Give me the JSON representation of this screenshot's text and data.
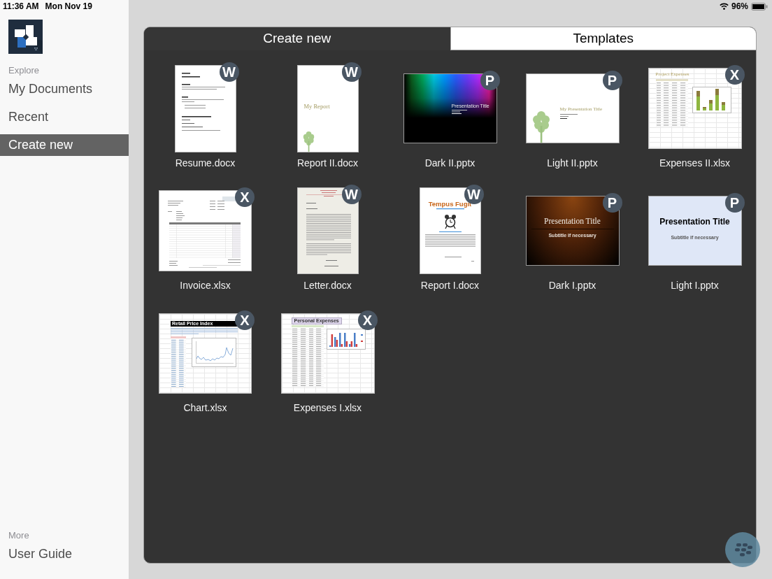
{
  "status_bar": {
    "time": "11:36 AM",
    "date": "Mon Nov 19",
    "battery": "96%"
  },
  "sidebar": {
    "sections": [
      {
        "heading": "Explore",
        "items": [
          {
            "label": "My Documents",
            "selected": false
          },
          {
            "label": "Recent",
            "selected": false
          },
          {
            "label": "Create new",
            "selected": true
          }
        ]
      },
      {
        "heading": "More",
        "items": [
          {
            "label": "User Guide",
            "selected": false
          }
        ]
      }
    ]
  },
  "tabs": [
    {
      "label": "Create new",
      "selected": true
    },
    {
      "label": "Templates",
      "selected": false
    }
  ],
  "templates": [
    {
      "name": "Resume.docx",
      "badge": "W",
      "preview": {
        "kind": "resume"
      }
    },
    {
      "name": "Report II.docx",
      "badge": "W",
      "preview": {
        "kind": "report",
        "title": "My Report"
      }
    },
    {
      "name": "Dark II.pptx",
      "badge": "P",
      "preview": {
        "kind": "spectrum-slide",
        "title": "Presentation Title"
      }
    },
    {
      "name": "Light II.pptx",
      "badge": "P",
      "preview": {
        "kind": "tree-slide",
        "title": "My Presentation Title"
      }
    },
    {
      "name": "Expenses II.xlsx",
      "badge": "X",
      "preview": {
        "kind": "expenses-sheet",
        "title": "Project Expenses"
      }
    },
    {
      "name": "Invoice.xlsx",
      "badge": "X",
      "preview": {
        "kind": "invoice"
      }
    },
    {
      "name": "Letter.docx",
      "badge": "W",
      "preview": {
        "kind": "letter"
      }
    },
    {
      "name": "Report I.docx",
      "badge": "W",
      "preview": {
        "kind": "clock-report",
        "title": "Tempus Fugit"
      }
    },
    {
      "name": "Dark I.pptx",
      "badge": "P",
      "preview": {
        "kind": "brown-slide",
        "title": "Presentation Title",
        "subtitle": "Subtitle if necessary"
      }
    },
    {
      "name": "Light I.pptx",
      "badge": "P",
      "preview": {
        "kind": "blue-slide",
        "title": "Presentation Title",
        "subtitle": "Subtitle if necessary"
      }
    },
    {
      "name": "Chart.xlsx",
      "badge": "X",
      "preview": {
        "kind": "line-chart-sheet",
        "title": "Retail Price Index"
      }
    },
    {
      "name": "Expenses I.xlsx",
      "badge": "X",
      "preview": {
        "kind": "bar-chart-sheet",
        "title": "Personal Expenses"
      }
    }
  ]
}
